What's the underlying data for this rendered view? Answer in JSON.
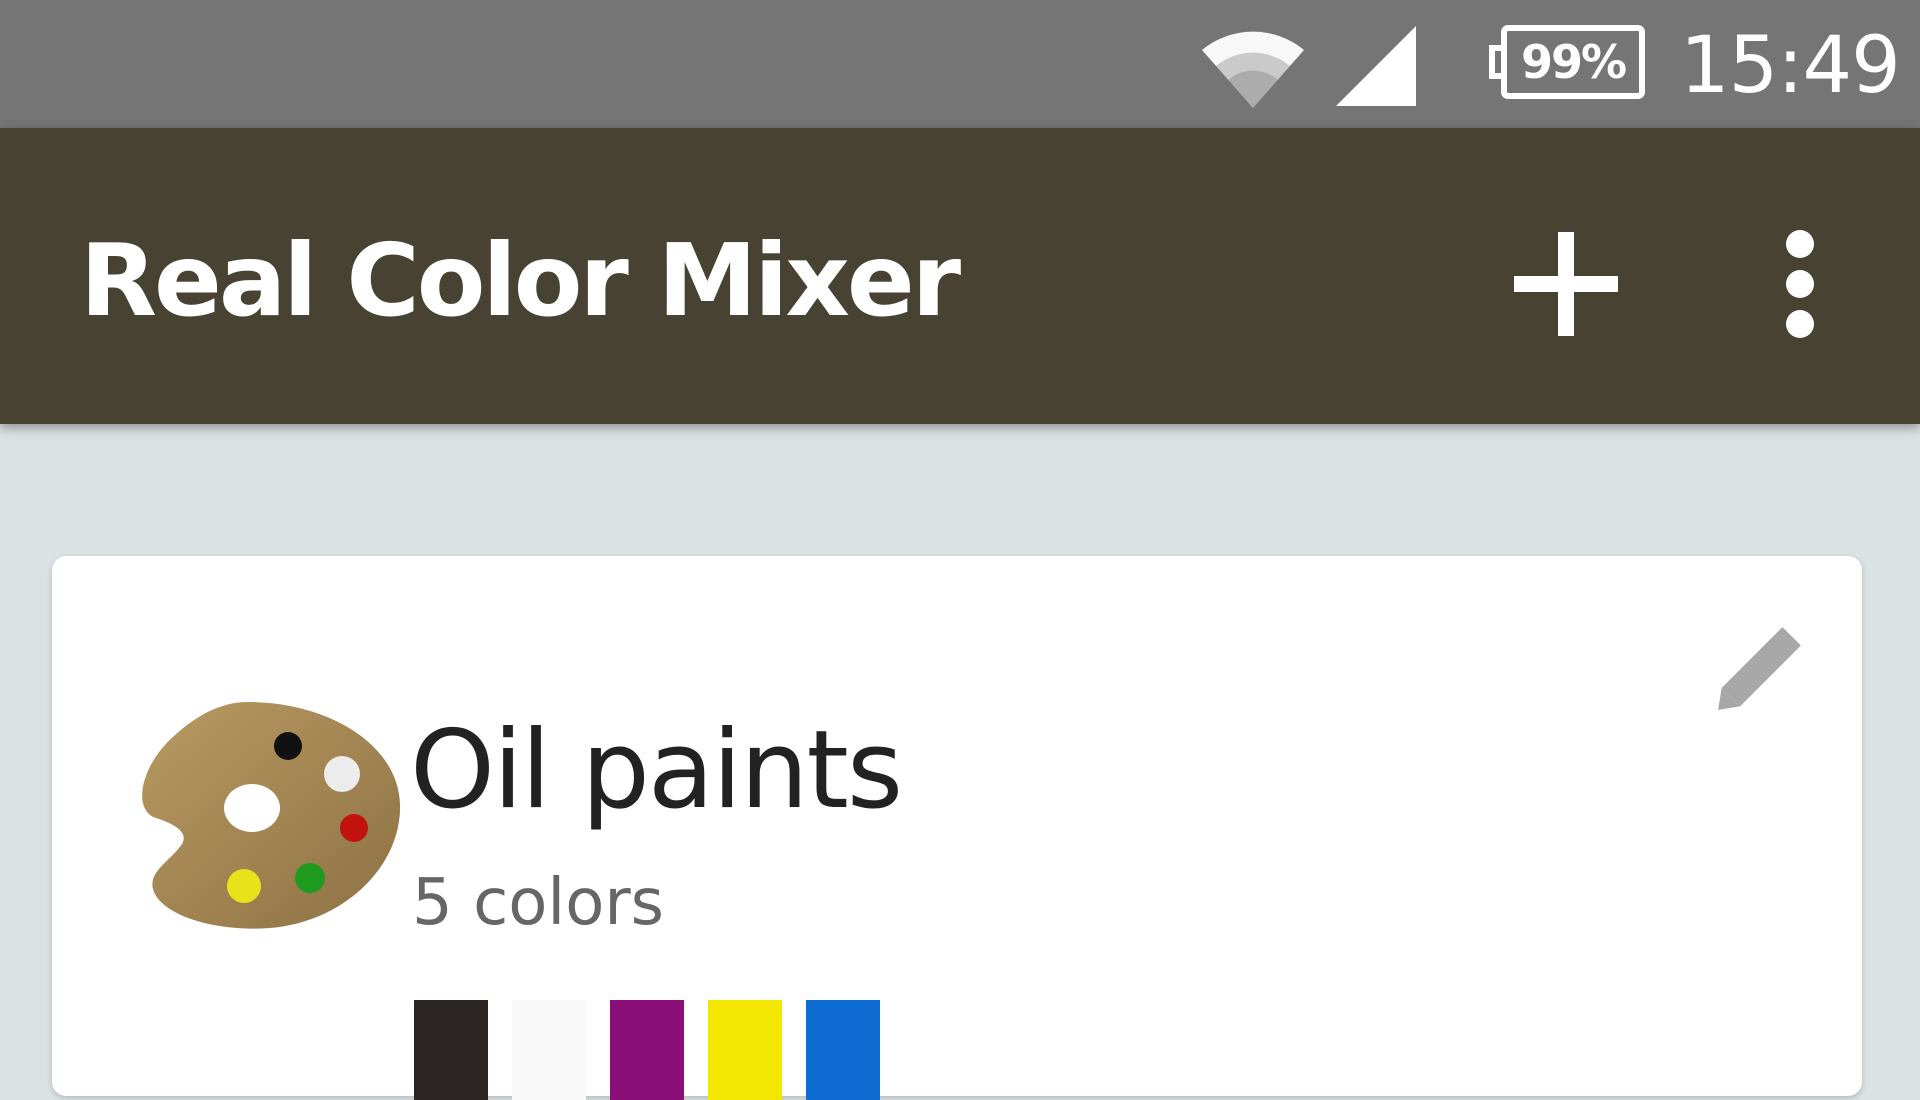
{
  "status_bar": {
    "battery_text": "99%",
    "time": "15:49",
    "icons": [
      "wifi-icon",
      "signal-icon",
      "battery-icon"
    ]
  },
  "app_bar": {
    "title": "Real Color Mixer",
    "icons": [
      "add-icon",
      "overflow-menu-icon"
    ],
    "background": "#484233"
  },
  "palette_card": {
    "title": "Oil paints",
    "subtitle": "5 colors",
    "icons": [
      "palette-icon",
      "edit-pencil-icon"
    ],
    "swatches": [
      {
        "name": "black",
        "color": "#2b2624"
      },
      {
        "name": "white",
        "color": "#f9f9f9"
      },
      {
        "name": "magenta",
        "color": "#8b0f79"
      },
      {
        "name": "yellow",
        "color": "#f3e600"
      },
      {
        "name": "blue",
        "color": "#0d6bd1"
      }
    ]
  },
  "colors": {
    "status_bar": "#757575",
    "background": "#dbe2e4",
    "card": "#ffffff"
  }
}
